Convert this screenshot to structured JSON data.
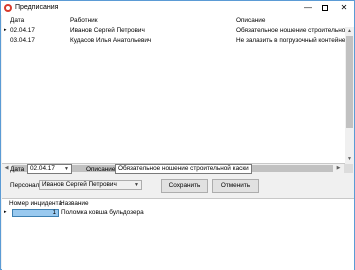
{
  "window": {
    "title": "Предписания",
    "minimize_glyph": "—",
    "close_glyph": "✕"
  },
  "top_grid": {
    "columns": [
      "Дата",
      "Работник",
      "Описание"
    ],
    "row_marker": "▸",
    "rows": [
      {
        "date": "02.04.17",
        "worker": "Иванов Сергей Петрович",
        "description": "Обязательное ношение строительной"
      },
      {
        "date": "03.04.17",
        "worker": "Кудасов Илья Анатольевич",
        "description": "Не залазить в погрузочный контейнер"
      }
    ],
    "scroll_up": "▲",
    "scroll_down": "▼",
    "scroll_left": "◀",
    "scroll_right": "▶"
  },
  "form": {
    "date_label": "Дата",
    "date_value": "02.04.17",
    "date_dropdown_glyph": "▼",
    "description_label": "Описание",
    "description_value": "Обязательное ношение строительной каски",
    "personnel_label": "Персонал",
    "personnel_value": "Иванов Сергей Петрович",
    "personnel_dropdown_glyph": "▼",
    "save_label": "Сохранить",
    "cancel_label": "Отменить"
  },
  "bottom_grid": {
    "columns": [
      "Номер инцидента",
      "Название"
    ],
    "row_marker": "▸",
    "rows": [
      {
        "number": "1",
        "name": "Поломка ковша бульдозера"
      }
    ]
  }
}
